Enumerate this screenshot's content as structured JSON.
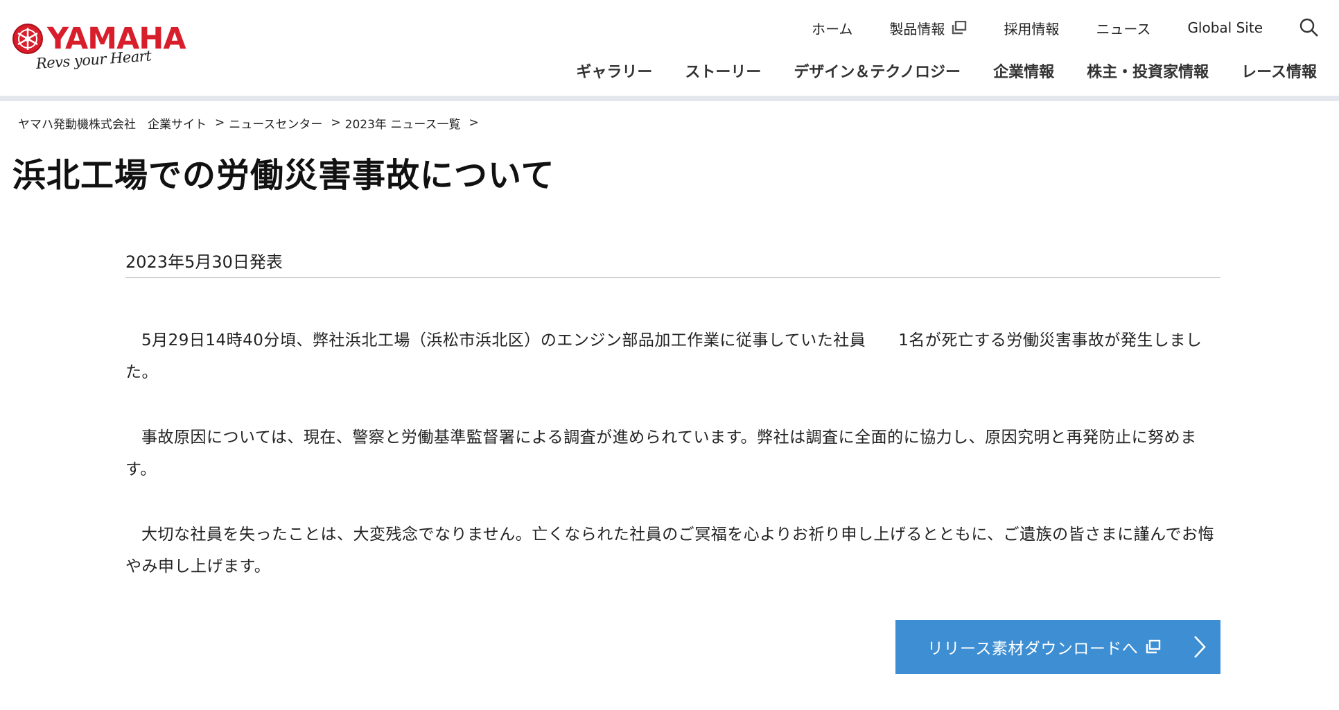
{
  "brand": {
    "name": "YAMAHA",
    "tagline": "Revs your Heart",
    "colors": {
      "brand_red": "#d81e2b",
      "button_blue": "#3d8ed2",
      "rule_gray": "#e4e8ee"
    }
  },
  "util_nav": {
    "items": [
      "ホーム",
      "製品情報",
      "採用情報",
      "ニュース",
      "Global Site"
    ],
    "external_icon": "external-window-icon",
    "search_icon": "search-icon"
  },
  "main_nav": {
    "items": [
      "ギャラリー",
      "ストーリー",
      "デザイン＆テクノロジー",
      "企業情報",
      "株主・投資家情報",
      "レース情報"
    ]
  },
  "breadcrumb": {
    "items": [
      "ヤマハ発動機株式会社　企業サイト",
      "ニュースセンター",
      "2023年 ニュース一覧"
    ],
    "separator": ">"
  },
  "article": {
    "title": "浜北工場での労働災害事故について",
    "date": "2023年5月30日発表",
    "paragraphs": [
      "5月29日14時40分頃、弊社浜北工場（浜松市浜北区）のエンジン部品加工作業に従事していた社員　　1名が死亡する労働災害事故が発生しました。",
      "事故原因については、現在、警察と労働基準監督署による調査が進められています。弊社は調査に全面的に協力し、原因究明と再発防止に努めます。",
      "大切な社員を失ったことは、大変残念でなりません。亡くなられた社員のご冥福を心よりお祈り申し上げるとともに、ご遺族の皆さまに謹んでお悔やみ申し上げます。"
    ],
    "download_button": "リリース素材ダウンロードへ"
  }
}
